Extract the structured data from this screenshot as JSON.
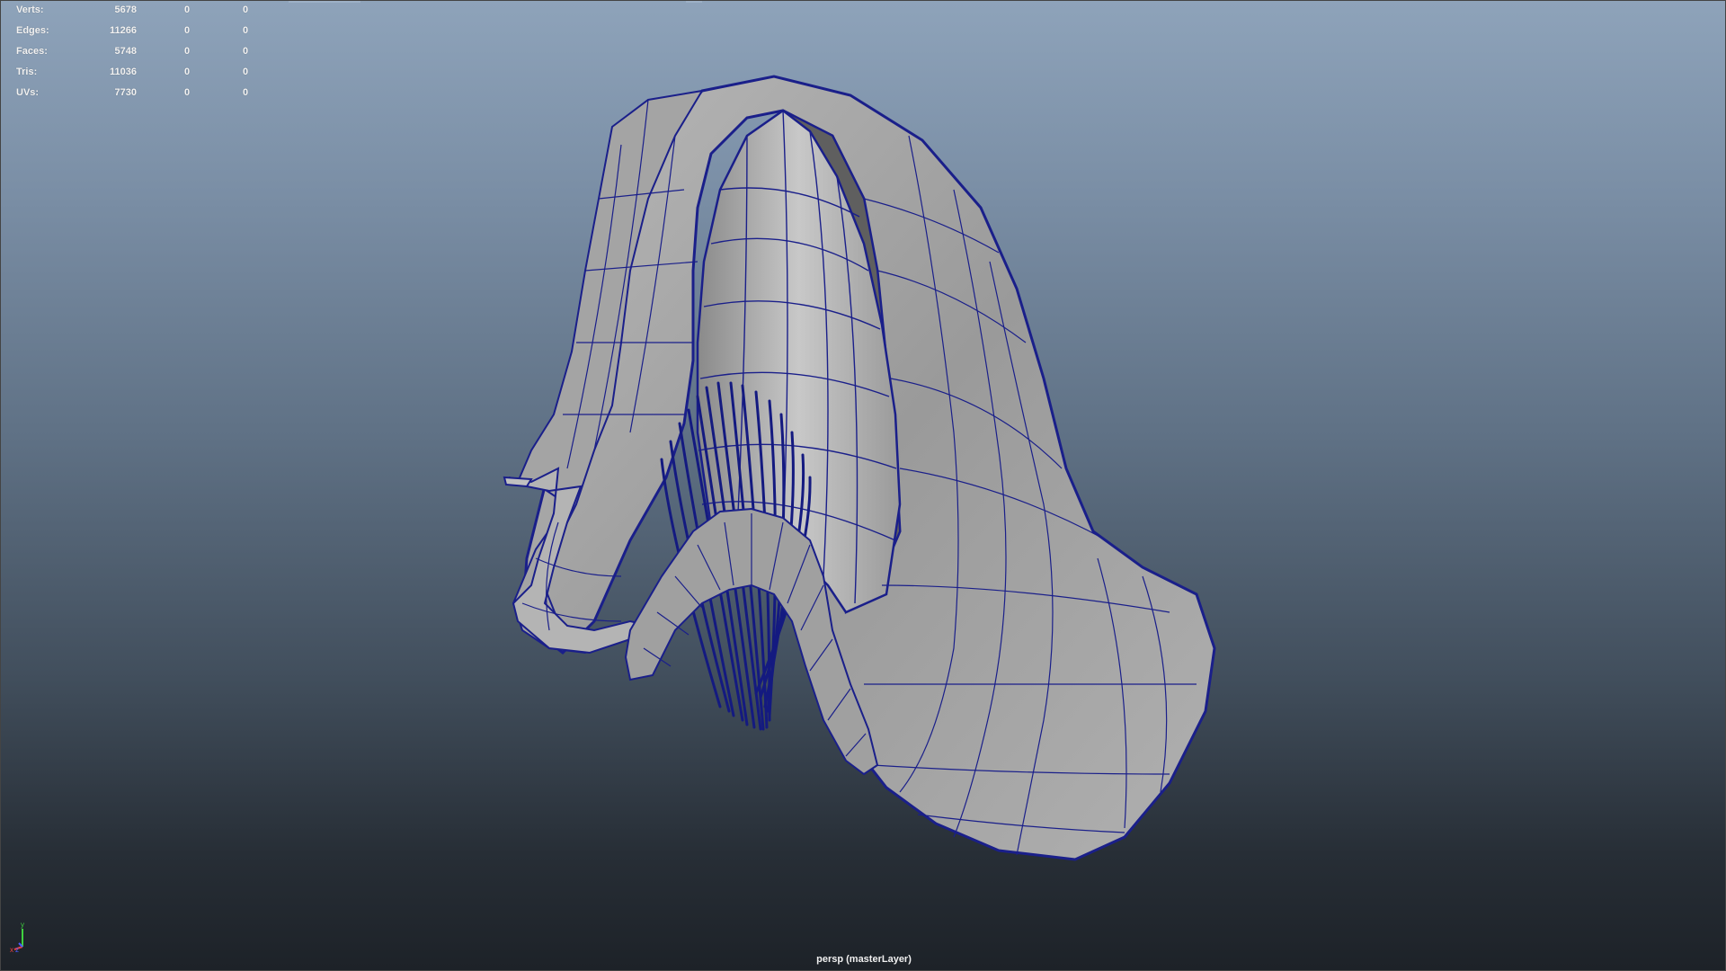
{
  "hud": {
    "rows": [
      {
        "label": "Verts:",
        "value": "5678",
        "selected": "0",
        "component": "0"
      },
      {
        "label": "Edges:",
        "value": "11266",
        "selected": "0",
        "component": "0"
      },
      {
        "label": "Faces:",
        "value": "5748",
        "selected": "0",
        "component": "0"
      },
      {
        "label": "Tris:",
        "value": "11036",
        "selected": "0",
        "component": "0"
      },
      {
        "label": "UVs:",
        "value": "7730",
        "selected": "0",
        "component": "0"
      }
    ]
  },
  "viewport": {
    "camera_label": "persp (masterLayer)",
    "axis_labels": {
      "y": "y",
      "x": "x",
      "z": "z"
    }
  },
  "colors": {
    "wireframe": "#1a1f8a",
    "surface_light": "#c3c3c3",
    "surface_dark": "#6a6a6a",
    "axis_y": "#3fd13f",
    "axis_x": "#e84040",
    "axis_z": "#4a5cff"
  },
  "icons": [
    "axis-gizmo-icon"
  ]
}
